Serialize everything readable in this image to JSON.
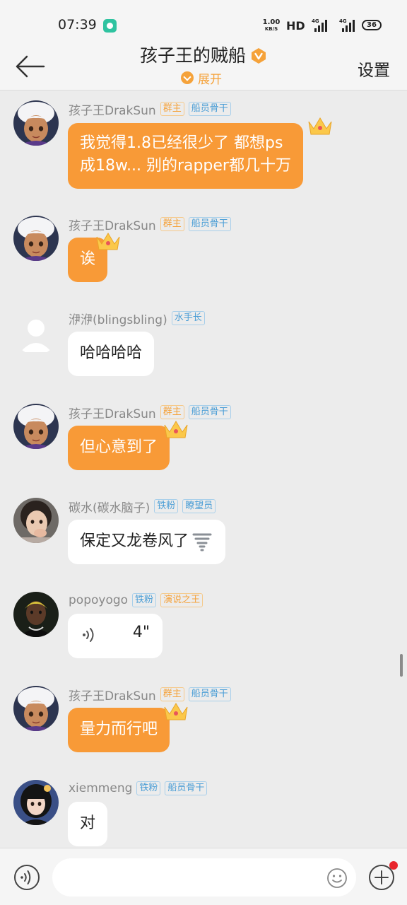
{
  "status_bar": {
    "time": "07:39",
    "net_speed": "1.00",
    "net_unit": "KB/S",
    "hd_label": "HD",
    "sim1_label": "4G",
    "sim2_label": "4G",
    "battery": "36"
  },
  "header": {
    "title": "孩子王的贼船",
    "expand_label": "展开",
    "settings_label": "设置"
  },
  "messages": [
    {
      "sender": "孩子王DrakSun",
      "tags": [
        "群主",
        "船员骨干"
      ],
      "text_lines": [
        "我觉得1.8已经很少了 都想ps",
        "成18w... 别的rapper都几十万"
      ],
      "bubble": "orange"
    },
    {
      "sender": "孩子王DrakSun",
      "tags": [
        "群主",
        "船员骨干"
      ],
      "text_lines": [
        "诶"
      ],
      "bubble": "orange"
    },
    {
      "sender": "洢洢(blingsbling)",
      "tags": [
        "水手长"
      ],
      "text_lines": [
        "哈哈哈哈"
      ],
      "bubble": "white"
    },
    {
      "sender": "孩子王DrakSun",
      "tags": [
        "群主",
        "船员骨干"
      ],
      "text_lines": [
        "但心意到了"
      ],
      "bubble": "orange"
    },
    {
      "sender": "碳水(碳水脑子)",
      "tags": [
        "铁粉",
        "瞭望员"
      ],
      "text_lines": [
        "保定又龙卷风了"
      ],
      "bubble": "white"
    },
    {
      "sender": "popoyogo",
      "tags": [
        "铁粉",
        "演说之王"
      ],
      "voice_duration": "4\"",
      "bubble": "white"
    },
    {
      "sender": "孩子王DrakSun",
      "tags": [
        "群主",
        "船员骨干"
      ],
      "text_lines": [
        "量力而行吧"
      ],
      "bubble": "orange"
    },
    {
      "sender": "xiemmeng",
      "tags": [
        "铁粉",
        "船员骨干"
      ],
      "text_lines": [
        "对"
      ],
      "bubble": "white"
    }
  ],
  "input_bar": {
    "placeholder": ""
  },
  "colors": {
    "accent_orange": "#f89a37",
    "tag_orange": "#f5a23a",
    "tag_blue": "#4b9ed6",
    "background": "#ececec",
    "notification_dot": "#e8242b"
  }
}
